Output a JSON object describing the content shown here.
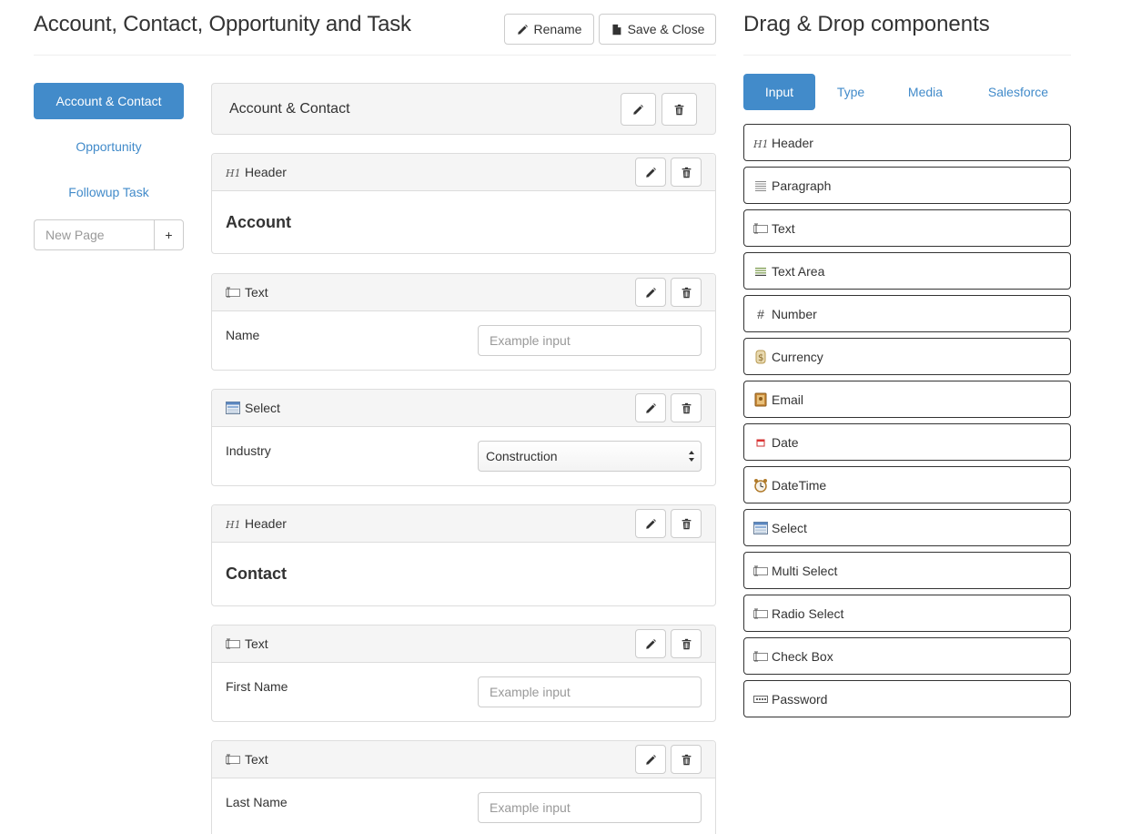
{
  "header": {
    "title": "Account, Contact, Opportunity and Task",
    "rename_label": "Rename",
    "save_close_label": "Save & Close"
  },
  "nav": {
    "pages": [
      {
        "label": "Account & Contact",
        "active": true
      },
      {
        "label": "Opportunity",
        "active": false
      },
      {
        "label": "Followup Task",
        "active": false
      }
    ],
    "new_page_placeholder": "New Page",
    "add_label": "+"
  },
  "page_panel": {
    "title": "Account & Contact"
  },
  "components": [
    {
      "type_label": "Header",
      "icon": "h1-icon",
      "heading": "Account"
    },
    {
      "type_label": "Text",
      "icon": "text-field-icon",
      "label": "Name",
      "placeholder": "Example input"
    },
    {
      "type_label": "Select",
      "icon": "select-icon",
      "label": "Industry",
      "value": "Construction"
    },
    {
      "type_label": "Header",
      "icon": "h1-icon",
      "heading": "Contact"
    },
    {
      "type_label": "Text",
      "icon": "text-field-icon",
      "label": "First Name",
      "placeholder": "Example input"
    },
    {
      "type_label": "Text",
      "icon": "text-field-icon",
      "label": "Last Name",
      "placeholder": "Example input"
    }
  ],
  "palette": {
    "title": "Drag & Drop components",
    "tabs": [
      {
        "label": "Input",
        "active": true
      },
      {
        "label": "Type",
        "active": false
      },
      {
        "label": "Media",
        "active": false
      },
      {
        "label": "Salesforce",
        "active": false
      }
    ],
    "items": [
      {
        "label": "Header",
        "icon": "h1-icon"
      },
      {
        "label": "Paragraph",
        "icon": "paragraph-icon"
      },
      {
        "label": "Text",
        "icon": "text-field-icon"
      },
      {
        "label": "Text Area",
        "icon": "text-area-icon"
      },
      {
        "label": "Number",
        "icon": "hash-icon"
      },
      {
        "label": "Currency",
        "icon": "dollar-icon"
      },
      {
        "label": "Email",
        "icon": "address-book-icon"
      },
      {
        "label": "Date",
        "icon": "calendar-icon"
      },
      {
        "label": "DateTime",
        "icon": "alarm-clock-icon"
      },
      {
        "label": "Select",
        "icon": "select-icon"
      },
      {
        "label": "Multi Select",
        "icon": "text-field-icon"
      },
      {
        "label": "Radio Select",
        "icon": "text-field-icon"
      },
      {
        "label": "Check Box",
        "icon": "text-field-icon"
      },
      {
        "label": "Password",
        "icon": "password-icon"
      }
    ]
  },
  "colors": {
    "primary": "#428bca",
    "panel_bg": "#f5f5f5",
    "border": "#dddddd"
  }
}
